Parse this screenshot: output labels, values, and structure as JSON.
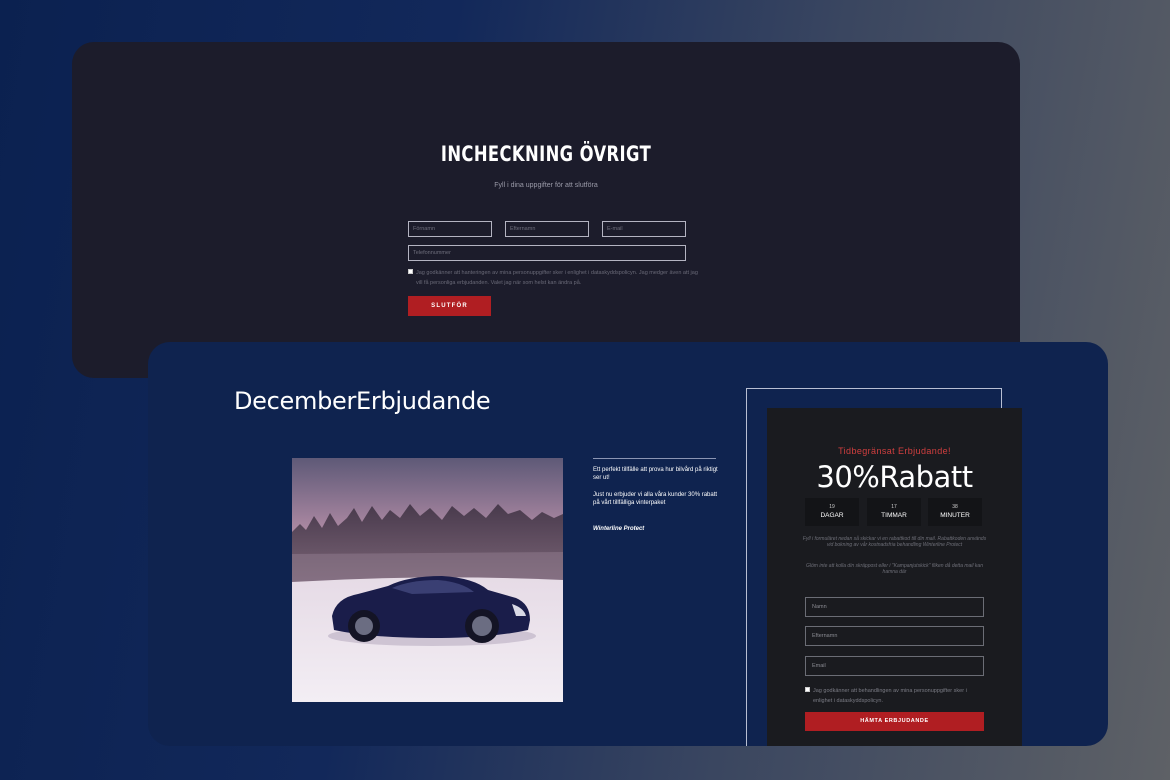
{
  "checkin": {
    "title": "INCHECKNING ÖVRIGT",
    "subtitle": "Fyll i dina uppgifter för att slutföra",
    "fields": {
      "firstname_placeholder": "Förnamn",
      "lastname_placeholder": "Efternamn",
      "email_placeholder": "E-mail",
      "phone_placeholder": "Telefonnummer"
    },
    "consent_text": "Jag godkänner att hanteringen av mina personuppgifter sker i enlighet i dataskyddspolicyn. Jag medger även att jag vill få personliga erbjudanden. Valet jag när som helst kan ändra på.",
    "submit_label": "SLUTFÖR"
  },
  "campaign": {
    "title": "DecemberErbjudande",
    "text_1": "Ett perfekt tillfälle att prova hur bilvård på riktigt ser ut!",
    "text_2": "Just nu erbjuder vi alla våra kunder 30% rabatt på vårt tillfälliga vinterpaket",
    "product": "Winterline Protect"
  },
  "offer": {
    "label": "Tidbegränsat Erbjudande!",
    "headline": "30%Rabatt",
    "countdown": [
      {
        "value": "19",
        "unit": "DAGAR"
      },
      {
        "value": "17",
        "unit": "TIMMAR"
      },
      {
        "value": "38",
        "unit": "MINUTER"
      }
    ],
    "text_1": "Fyll i formuläret nedan så skickar vi en rabattkod till din mail. Rabattkoden används vid bokning av vår kostnadsfria behandling Winterline Protect",
    "text_2": "Glöm inte att kolla din skräppost eller i \"Kampanjutskick\" fliken då detta mail kan hamna där",
    "fields": {
      "name_placeholder": "Namn",
      "lastname_placeholder": "Efternamn",
      "email_placeholder": "Email"
    },
    "consent_text": "Jag godkänner att behandlingen av mina personuppgifter sker i enlighet i dataskyddspolicyn.",
    "cta_label": "HÄMTA ERBJUDANDE"
  },
  "colors": {
    "accent_red": "#b01e22",
    "card_dark": "#1c1c2b",
    "card_navy": "#0f234f",
    "panel": "#1a1b1f"
  }
}
